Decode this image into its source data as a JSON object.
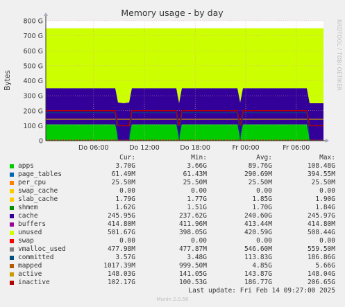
{
  "chart_data": {
    "type": "area",
    "title": "Memory usage - by day",
    "ylabel": "Bytes",
    "side_text": "RRDTOOL / TOBI OETIKER",
    "x_ticks": [
      "Do 06:00",
      "Do 12:00",
      "Do 18:00",
      "Fr 00:00",
      "Fr 06:00"
    ],
    "y_ticks": [
      "0",
      "100 G",
      "200 G",
      "300 G",
      "400 G",
      "500 G",
      "600 G",
      "700 G",
      "800 G"
    ],
    "ylim": [
      0,
      800
    ],
    "x_domain": [
      0,
      100
    ],
    "x_tick_positions": [
      17.2,
      35.5,
      53.8,
      72.0,
      90.2
    ],
    "grid": true,
    "series": [
      {
        "name": "apps",
        "color": "#00cc00",
        "cur": "3.70G",
        "min": "3.66G",
        "avg": "89.76G",
        "max": "108.48G"
      },
      {
        "name": "page_tables",
        "color": "#0066b3",
        "cur": "61.49M",
        "min": "61.43M",
        "avg": "290.69M",
        "max": "394.55M"
      },
      {
        "name": "per_cpu",
        "color": "#ff8000",
        "cur": "25.50M",
        "min": "25.50M",
        "avg": "25.50M",
        "max": "25.50M"
      },
      {
        "name": "swap_cache",
        "color": "#ffcc00",
        "cur": "0.00",
        "min": "0.00",
        "avg": "0.00",
        "max": "0.00"
      },
      {
        "name": "slab_cache",
        "color": "#ffcc00",
        "cur": "1.79G",
        "min": "1.77G",
        "avg": "1.85G",
        "max": "1.90G"
      },
      {
        "name": "shmem",
        "color": "#008f00",
        "cur": "1.62G",
        "min": "1.51G",
        "avg": "1.70G",
        "max": "1.84G"
      },
      {
        "name": "cache",
        "color": "#330099",
        "cur": "245.95G",
        "min": "237.62G",
        "avg": "240.60G",
        "max": "245.97G"
      },
      {
        "name": "buffers",
        "color": "#990099",
        "cur": "414.80M",
        "min": "411.96M",
        "avg": "413.44M",
        "max": "414.80M"
      },
      {
        "name": "unused",
        "color": "#ccff00",
        "cur": "501.67G",
        "min": "398.05G",
        "avg": "420.59G",
        "max": "508.44G"
      },
      {
        "name": "swap",
        "color": "#ff0000",
        "cur": "0.00",
        "min": "0.00",
        "avg": "0.00",
        "max": "0.00"
      },
      {
        "name": "vmalloc_used",
        "color": "#808080",
        "cur": "477.98M",
        "min": "477.87M",
        "avg": "546.60M",
        "max": "559.50M"
      },
      {
        "name": "committed",
        "color": "#004d80",
        "cur": "3.57G",
        "min": "3.48G",
        "avg": "113.83G",
        "max": "186.86G"
      },
      {
        "name": "mapped",
        "color": "#b35900",
        "cur": "1017.39M",
        "min": "999.50M",
        "avg": "4.85G",
        "max": "5.66G"
      },
      {
        "name": "active",
        "color": "#cc9900",
        "cur": "148.03G",
        "min": "141.05G",
        "avg": "143.87G",
        "max": "148.04G"
      },
      {
        "name": "inactive",
        "color": "#b30000",
        "cur": "102.17G",
        "min": "100.53G",
        "avg": "186.77G",
        "max": "206.65G"
      }
    ],
    "stack_profile": {
      "x": [
        0,
        25,
        26,
        28,
        30,
        31,
        47,
        48,
        49,
        69,
        70,
        71,
        94,
        95,
        100
      ],
      "apps": [
        108,
        108,
        4,
        4,
        4,
        108,
        108,
        4,
        108,
        108,
        4,
        108,
        108,
        4,
        4
      ],
      "cache_top": [
        350,
        350,
        255,
        250,
        255,
        350,
        350,
        250,
        350,
        350,
        255,
        350,
        350,
        250,
        250
      ],
      "total": [
        750,
        750,
        750,
        750,
        750,
        750,
        750,
        750,
        750,
        750,
        750,
        750,
        750,
        750,
        750
      ],
      "inactive": [
        200,
        200,
        100,
        100,
        100,
        200,
        200,
        100,
        200,
        200,
        100,
        200,
        200,
        100,
        100
      ],
      "active": [
        143,
        143,
        143,
        143,
        143,
        143,
        143,
        143,
        143,
        143,
        143,
        143,
        143,
        143,
        143
      ],
      "committed": [
        186,
        186,
        4,
        4,
        4,
        186,
        186,
        4,
        186,
        186,
        4,
        186,
        186,
        4,
        4
      ]
    }
  },
  "legend": {
    "headers": {
      "cur": "Cur:",
      "min": "Min:",
      "avg": "Avg:",
      "max": "Max:"
    }
  },
  "footer": {
    "last_update": "Last update: Fri Feb 14 09:27:00 2025",
    "munin": "Munin 2.0.56"
  }
}
